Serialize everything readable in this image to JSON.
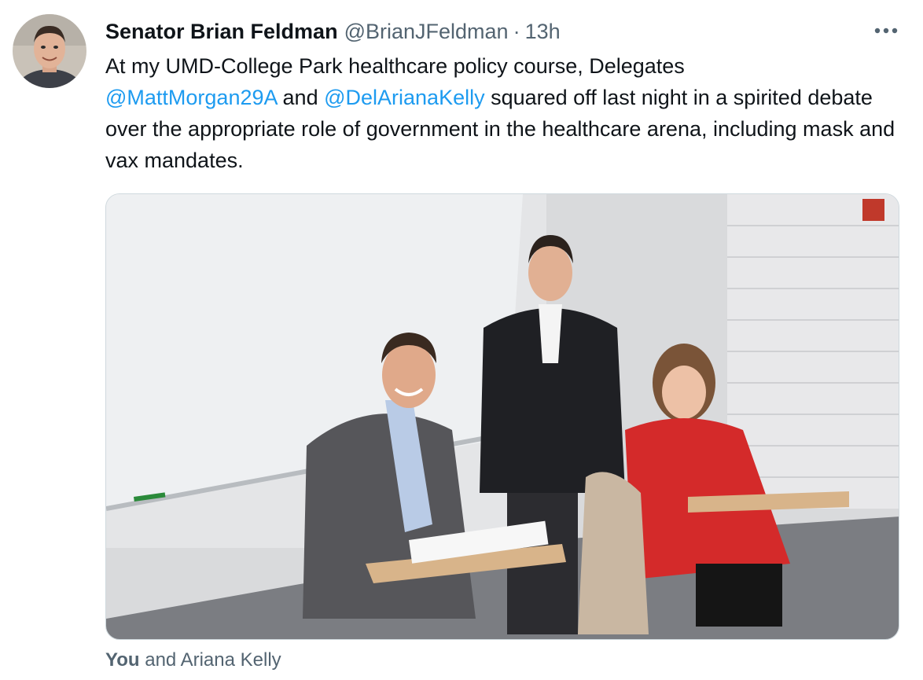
{
  "tweet": {
    "author_name": "Senator Brian Feldman",
    "author_handle": "@BrianJFeldman",
    "separator": "·",
    "timestamp": "13h",
    "text_part1": "At my UMD-College Park healthcare policy course, Delegates",
    "mention1": "@MattMorgan29A",
    "text_part2": " and ",
    "mention2": "@DelArianaKelly",
    "text_part3": " squared off last night in a spirited debate over the appropriate role of government in the healthcare arena, including mask and vax mandates."
  },
  "media": {
    "tagged_you": "You",
    "tagged_rest": " and Ariana Kelly"
  },
  "icons": {
    "more": "more-options-icon"
  },
  "colors": {
    "link": "#1d9bf0",
    "secondary_text": "#536471",
    "primary_text": "#0f1419"
  }
}
